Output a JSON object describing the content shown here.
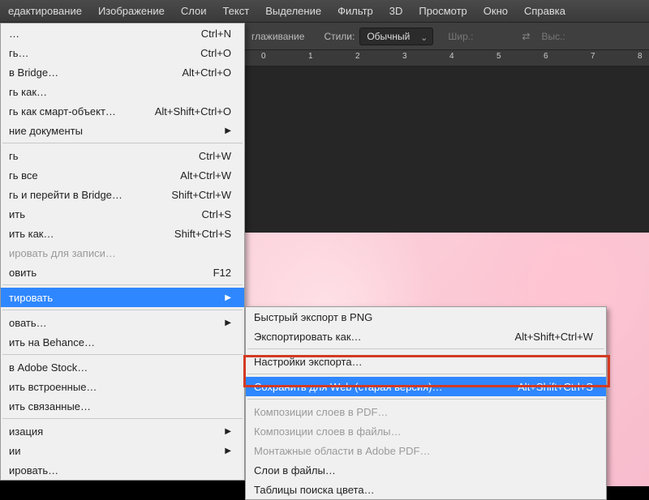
{
  "menubar": {
    "items": [
      "едактирование",
      "Изображение",
      "Слои",
      "Текст",
      "Выделение",
      "Фильтр",
      "3D",
      "Просмотр",
      "Окно",
      "Справка"
    ]
  },
  "optbar": {
    "smooth_label": "глаживание",
    "styles_label": "Стили:",
    "style_value": "Обычный",
    "width_label": "Шир.:",
    "height_label": "Выс.:"
  },
  "ruler": {
    "marks": [
      "0",
      "1",
      "2",
      "3",
      "4",
      "5",
      "6",
      "7",
      "8"
    ]
  },
  "main_menu": [
    {
      "label": "…",
      "shortcut": "Ctrl+N"
    },
    {
      "label": "гь…",
      "shortcut": "Ctrl+O"
    },
    {
      "label": "в Bridge…",
      "shortcut": "Alt+Ctrl+O"
    },
    {
      "label": "гь как…",
      "shortcut": ""
    },
    {
      "label": "гь как смарт-объект…",
      "shortcut": "Alt+Shift+Ctrl+O"
    },
    {
      "label": "ние документы",
      "shortcut": "",
      "arrow": true
    },
    {
      "sep": true
    },
    {
      "label": "гь",
      "shortcut": "Ctrl+W"
    },
    {
      "label": "гь все",
      "shortcut": "Alt+Ctrl+W"
    },
    {
      "label": "гь и перейти в Bridge…",
      "shortcut": "Shift+Ctrl+W"
    },
    {
      "label": "ить",
      "shortcut": "Ctrl+S"
    },
    {
      "label": "ить как…",
      "shortcut": "Shift+Ctrl+S"
    },
    {
      "label": "ировать для записи…",
      "shortcut": "",
      "disabled": true
    },
    {
      "label": "овить",
      "shortcut": "F12"
    },
    {
      "sep": true
    },
    {
      "label": "тировать",
      "shortcut": "",
      "arrow": true,
      "hl": true
    },
    {
      "sep": true
    },
    {
      "label": "овать…",
      "shortcut": "",
      "arrow": true
    },
    {
      "label": "ить на Behance…",
      "shortcut": ""
    },
    {
      "sep": true
    },
    {
      "label": "в Adobe Stock…",
      "shortcut": ""
    },
    {
      "label": "ить встроенные…",
      "shortcut": ""
    },
    {
      "label": "ить связанные…",
      "shortcut": ""
    },
    {
      "sep": true
    },
    {
      "label": "изация",
      "shortcut": "",
      "arrow": true
    },
    {
      "label": "ии",
      "shortcut": "",
      "arrow": true
    },
    {
      "label": "ировать…",
      "shortcut": ""
    }
  ],
  "sub_menu": [
    {
      "label": "Быстрый экспорт в PNG",
      "shortcut": ""
    },
    {
      "label": "Экспортировать как…",
      "shortcut": "Alt+Shift+Ctrl+W"
    },
    {
      "sep": true
    },
    {
      "label": "Настройки экспорта…",
      "shortcut": ""
    },
    {
      "sep": true
    },
    {
      "label": "Сохранить для Web (старая версия)…",
      "shortcut": "Alt+Shift+Ctrl+S",
      "hl": true
    },
    {
      "sep": true
    },
    {
      "label": "Композиции слоев в PDF…",
      "shortcut": "",
      "disabled": true
    },
    {
      "label": "Композиции слоев в файлы…",
      "shortcut": "",
      "disabled": true
    },
    {
      "label": "Монтажные области в Adobe PDF…",
      "shortcut": "",
      "disabled": true
    },
    {
      "label": "Слои в файлы…",
      "shortcut": ""
    },
    {
      "label": "Таблицы поиска цвета…",
      "shortcut": ""
    }
  ]
}
